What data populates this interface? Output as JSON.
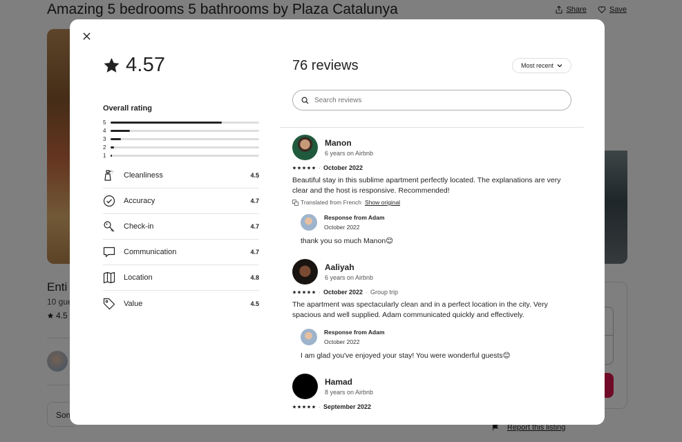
{
  "background": {
    "listing_title": "Amazing 5 bedrooms 5 bathrooms by Plaza Catalunya",
    "share_label": "Share",
    "save_label": "Save",
    "entire_text": "Enti",
    "guests_text": "10 gue",
    "rating_text": "4.5",
    "some_text": "Som",
    "report_label": "Report this listing"
  },
  "modal": {
    "overall": {
      "rating": "4.57",
      "label": "Overall rating",
      "distribution": [
        {
          "stars": "5",
          "fraction": 0.75
        },
        {
          "stars": "4",
          "fraction": 0.13
        },
        {
          "stars": "3",
          "fraction": 0.07
        },
        {
          "stars": "2",
          "fraction": 0.025
        },
        {
          "stars": "1",
          "fraction": 0.01
        }
      ]
    },
    "categories": [
      {
        "label": "Cleanliness",
        "value": "4.5",
        "icon": "spray-bottle-icon"
      },
      {
        "label": "Accuracy",
        "value": "4.7",
        "icon": "check-circle-icon"
      },
      {
        "label": "Check-in",
        "value": "4.7",
        "icon": "key-icon"
      },
      {
        "label": "Communication",
        "value": "4.7",
        "icon": "chat-bubble-icon"
      },
      {
        "label": "Location",
        "value": "4.8",
        "icon": "map-icon"
      },
      {
        "label": "Value",
        "value": "4.5",
        "icon": "tag-icon"
      }
    ],
    "reviews_header": {
      "title": "76 reviews",
      "sort_label": "Most recent",
      "search_placeholder": "Search reviews"
    },
    "reviews": [
      {
        "name": "Manon",
        "tenure": "6 years on Airbnb",
        "rating": 5,
        "date": "October 2022",
        "text": "Beautiful stay in this sublime apartment perfectly located. The explanations are very clear and the host is responsive. Recommended!",
        "translated_note": "Translated from French",
        "show_original": "Show original",
        "response": {
          "from": "Response from Adam",
          "date": "October 2022",
          "text": "thank you so much Manon😊"
        }
      },
      {
        "name": "Aaliyah",
        "tenure": "6 years on Airbnb",
        "rating": 5,
        "date": "October 2022",
        "trip_type": "Group trip",
        "text": "The apartment was spectacularly clean and in a perfect location in the city. Very spacious and well supplied. Adam communicated quickly and effectively.",
        "response": {
          "from": "Response from Adam",
          "date": "October 2022",
          "text": "I am glad you've enjoyed your stay! You were wonderful guests😊"
        }
      },
      {
        "name": "Hamad",
        "tenure": "8 years on Airbnb",
        "rating": 5,
        "date": "September 2022"
      }
    ]
  },
  "colors": {
    "accent": "#e0174f",
    "text": "#222222",
    "muted": "#717171",
    "overlay": "rgba(0,0,0,0.5)"
  }
}
